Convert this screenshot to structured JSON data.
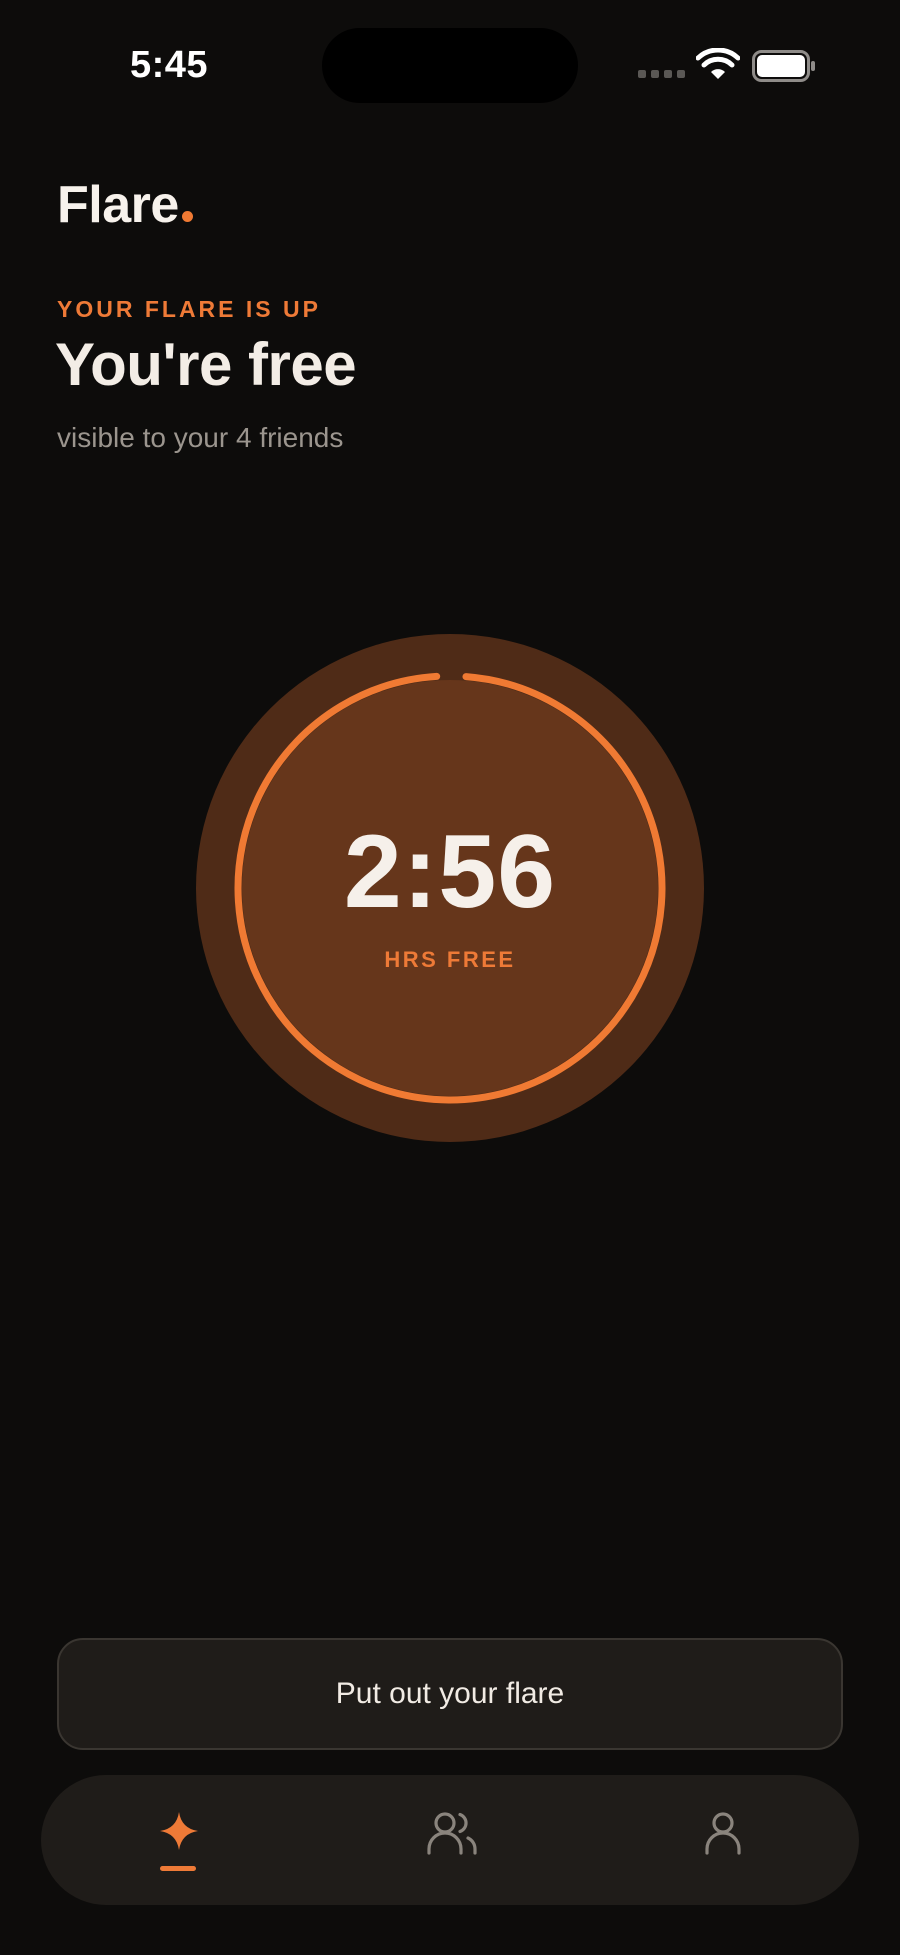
{
  "status_bar": {
    "time": "5:45"
  },
  "header": {
    "brand": "Flare"
  },
  "status": {
    "eyebrow": "YOUR FLARE IS UP",
    "headline": "You're free",
    "subtext": "visible to your 4 friends"
  },
  "timer": {
    "value": "2:56",
    "label": "HRS FREE",
    "progress_fraction": 0.99
  },
  "actions": {
    "put_out_label": "Put out your flare"
  },
  "tab_bar": {
    "tabs": [
      {
        "icon": "sparkle-icon",
        "active": true
      },
      {
        "icon": "friends-icon",
        "active": false
      },
      {
        "icon": "profile-icon",
        "active": false
      }
    ]
  },
  "colors": {
    "accent": "#ee7a37",
    "background": "#0d0c0b",
    "surface": "#1f1c19",
    "dial_outer": "#4f2b17",
    "dial_inner": "#66361b"
  }
}
